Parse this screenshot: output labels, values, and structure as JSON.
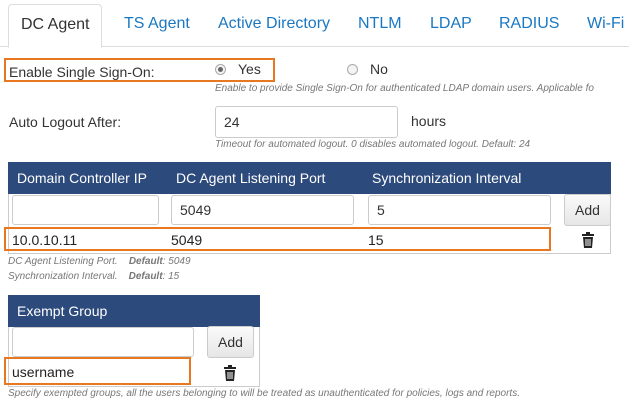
{
  "tabs": [
    {
      "label": "DC Agent",
      "active": true
    },
    {
      "label": "TS Agent"
    },
    {
      "label": "Active Directory"
    },
    {
      "label": "NTLM"
    },
    {
      "label": "LDAP"
    },
    {
      "label": "RADIUS"
    },
    {
      "label": "Wi-Fi"
    }
  ],
  "sso": {
    "label": "Enable Single Sign-On:",
    "options": [
      "Yes",
      "No"
    ],
    "selected": "Yes",
    "hint": "Enable to provide Single Sign-On for authenticated LDAP domain users. Applicable fo"
  },
  "logout": {
    "label": "Auto Logout After:",
    "value": "24",
    "unit": "hours",
    "hint": "Timeout for automated logout. 0 disables automated logout. Default: 24"
  },
  "dc_table": {
    "columns": [
      "Domain Controller IP",
      "DC Agent Listening Port",
      "Synchronization Interval"
    ],
    "inputs": {
      "ip": "",
      "port": "5049",
      "interval": "5"
    },
    "add_label": "Add",
    "rows": [
      {
        "ip": "10.0.10.11",
        "port": "5049",
        "interval": "15"
      }
    ],
    "notes": [
      {
        "text": "DC Agent Listening Port.",
        "key": "Default",
        "value": ": 5049"
      },
      {
        "text": "Synchronization Interval.",
        "key": "Default",
        "value": ": 15"
      }
    ]
  },
  "exempt": {
    "header": "Exempt Group",
    "input_value": "",
    "add_label": "Add",
    "rows": [
      "username"
    ],
    "hint": "Specify exempted groups, all the users belonging to will be treated as unauthenticated for policies, logs and reports."
  },
  "colors": {
    "accent": "#1a78c2",
    "highlight": "#e8771f",
    "header": "#2c4a7c"
  },
  "icons": {
    "delete": "trash-icon"
  }
}
